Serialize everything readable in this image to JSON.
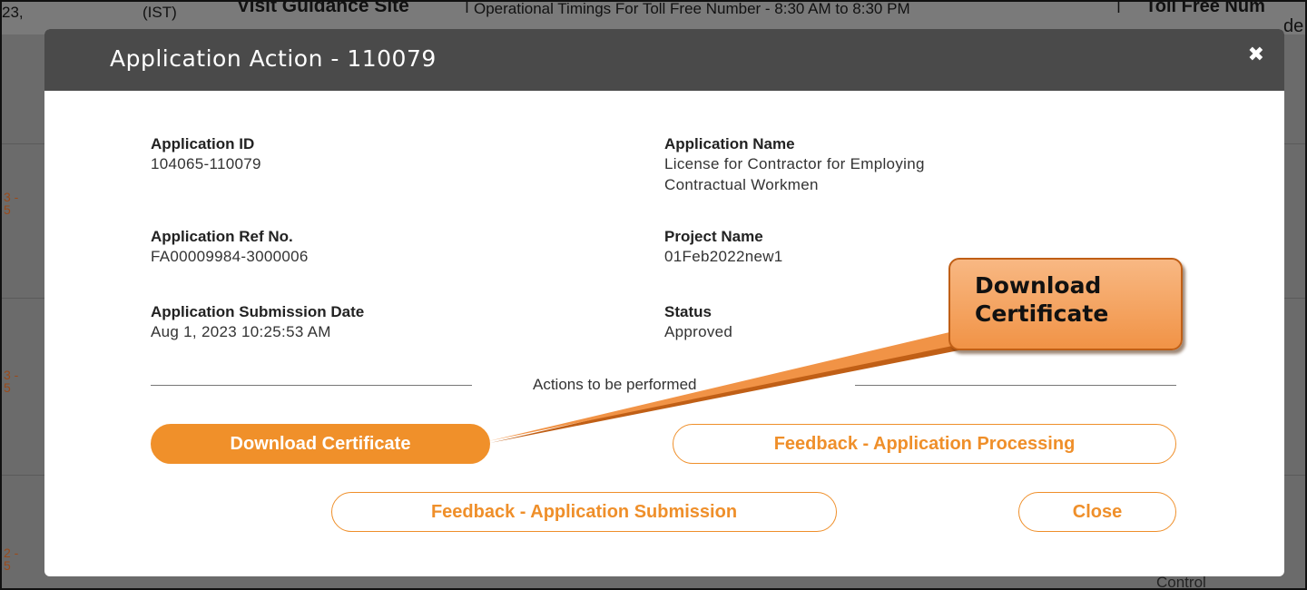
{
  "background": {
    "time_fragment": "23,",
    "ist_fragment": "(IST)",
    "guidance_link": "Visit Guidance Site",
    "timings": "Operational Timings For Toll Free Number - 8:30 AM to 8:30 PM",
    "toll_free": "Toll Free Num",
    "toll_free_2": "de",
    "control_text": "Control"
  },
  "modal": {
    "title": "Application Action - 110079",
    "fields": {
      "app_id": {
        "label": "Application ID",
        "value": "104065-110079"
      },
      "app_name": {
        "label": "Application Name",
        "value_line1": "License for Contractor for Employing",
        "value_line2": "Contractual Workmen"
      },
      "ref_no": {
        "label": "Application Ref No.",
        "value": "FA00009984-3000006"
      },
      "project": {
        "label": "Project Name",
        "value": "01Feb2022new1"
      },
      "submission": {
        "label": "Application Submission Date",
        "value": "Aug 1, 2023 10:25:53 AM"
      },
      "status": {
        "label": "Status",
        "value": "Approved"
      }
    },
    "actions_label": "Actions to be performed",
    "buttons": {
      "download": "Download Certificate",
      "feedback_processing": "Feedback - Application Processing",
      "feedback_submission": "Feedback - Application Submission",
      "close": "Close"
    }
  },
  "callout": {
    "line1": "Download",
    "line2": "Certificate"
  },
  "colors": {
    "accent": "#f0902a",
    "header": "#4a4a4a",
    "callout": "#f19346"
  }
}
